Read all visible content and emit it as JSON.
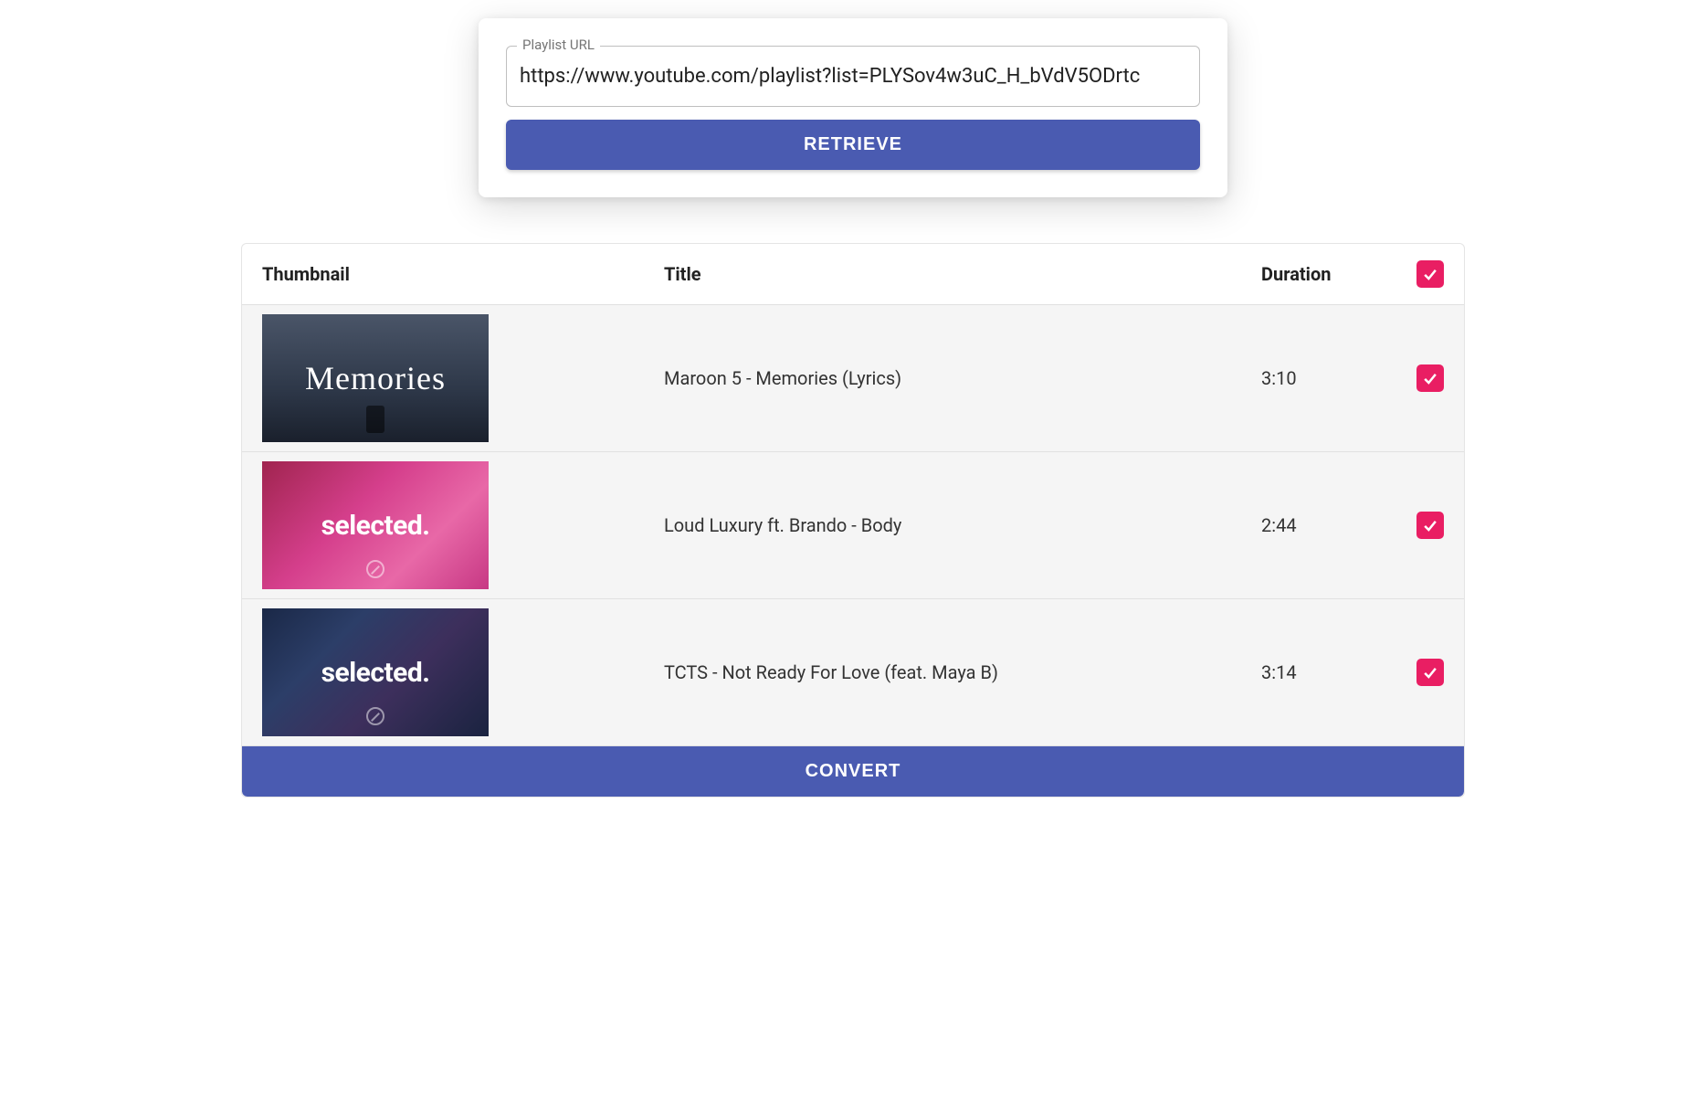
{
  "form": {
    "url_label": "Playlist URL",
    "url_value": "https://www.youtube.com/playlist?list=PLYSov4w3uC_H_bVdV5ODrtc",
    "retrieve_label": "RETRIEVE"
  },
  "table": {
    "headers": {
      "thumbnail": "Thumbnail",
      "title": "Title",
      "duration": "Duration"
    },
    "rows": [
      {
        "thumb_text": "Memories",
        "thumb_class": "thumb-1",
        "title": "Maroon 5 - Memories (Lyrics)",
        "duration": "3:10",
        "checked": true
      },
      {
        "thumb_text": "selected.",
        "thumb_class": "thumb-2",
        "title": "Loud Luxury ft. Brando - Body",
        "duration": "2:44",
        "checked": true
      },
      {
        "thumb_text": "selected.",
        "thumb_class": "thumb-3",
        "title": "TCTS - Not Ready For Love (feat. Maya B)",
        "duration": "3:14",
        "checked": true
      }
    ],
    "select_all_checked": true
  },
  "convert_label": "CONVERT",
  "colors": {
    "primary": "#4a5bb1",
    "accent": "#e91e63"
  }
}
